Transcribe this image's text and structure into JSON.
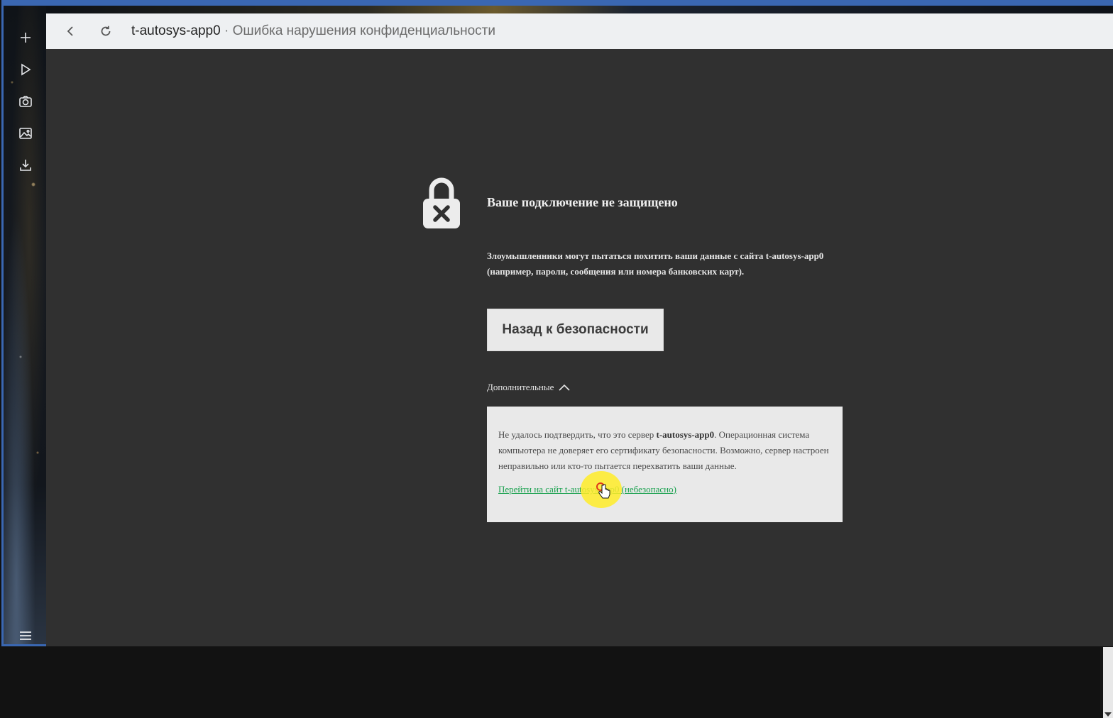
{
  "addressbar": {
    "host": "t-autosys-app0",
    "separator": " · ",
    "page_title": "Ошибка нарушения конфиденциальности"
  },
  "sidebar": {
    "icons": [
      "plus-icon",
      "play-icon",
      "camera-icon",
      "image-icon",
      "download-icon",
      "menu-icon"
    ]
  },
  "page": {
    "heading": "Ваше подключение не защищено",
    "description_prefix": "Злоумышленники могут пытаться похитить ваши данные с сайта ",
    "description_host": "t-autosys-app0",
    "description_suffix": " (например, пароли, сообщения или номера банковских карт).",
    "back_button": "Назад к безопасности",
    "more_toggle": "Дополнительные",
    "details_prefix": "Не удалось подтвердить, что это сервер ",
    "details_host": "t-autosys-app0",
    "details_suffix": ". Операционная система компьютера не доверяет его сертификату безопасности. Возможно, сервер настроен неправильно или кто-то пытается перехватить ваши данные.",
    "proceed_link": "Перейти на сайт t-autosys-app0 (небезопасно)"
  },
  "colors": {
    "page_bg": "#303030",
    "link": "#1aa14f",
    "window_border": "#3a67b2"
  }
}
